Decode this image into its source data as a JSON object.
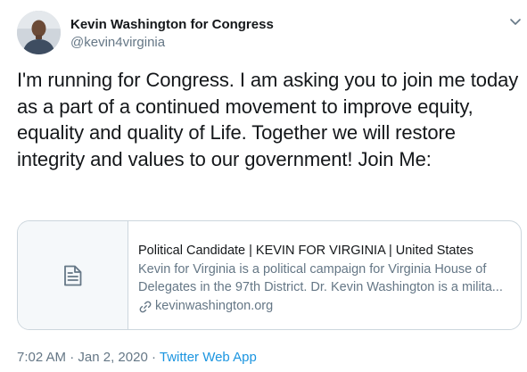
{
  "author": {
    "name": "Kevin Washington for Congress",
    "handle": "@kevin4virginia"
  },
  "icons": {
    "menu": "chevron-down-icon",
    "card_thumb": "document-icon",
    "link": "link-icon"
  },
  "tweet": {
    "text": "I'm running for Congress. I am asking you to join me today as a part of a continued movement to improve equity, equality and quality of Life. Together we will restore integrity and values to our government! Join Me:"
  },
  "card": {
    "title": "Political Candidate | KEVIN FOR VIRGINIA | United States",
    "description": "Kevin for Virginia is a political campaign for Virginia House of Delegates in the 97th District. Dr. Kevin Washington is a milita...",
    "domain": "kevinwashington.org"
  },
  "meta": {
    "time": "7:02 AM",
    "separator1": " · ",
    "date": "Jan 2, 2020",
    "separator2": " · ",
    "source": "Twitter Web App"
  },
  "colors": {
    "text_primary": "#14171a",
    "text_secondary": "#657786",
    "link": "#1b95e0",
    "border": "#ccd6dd"
  }
}
